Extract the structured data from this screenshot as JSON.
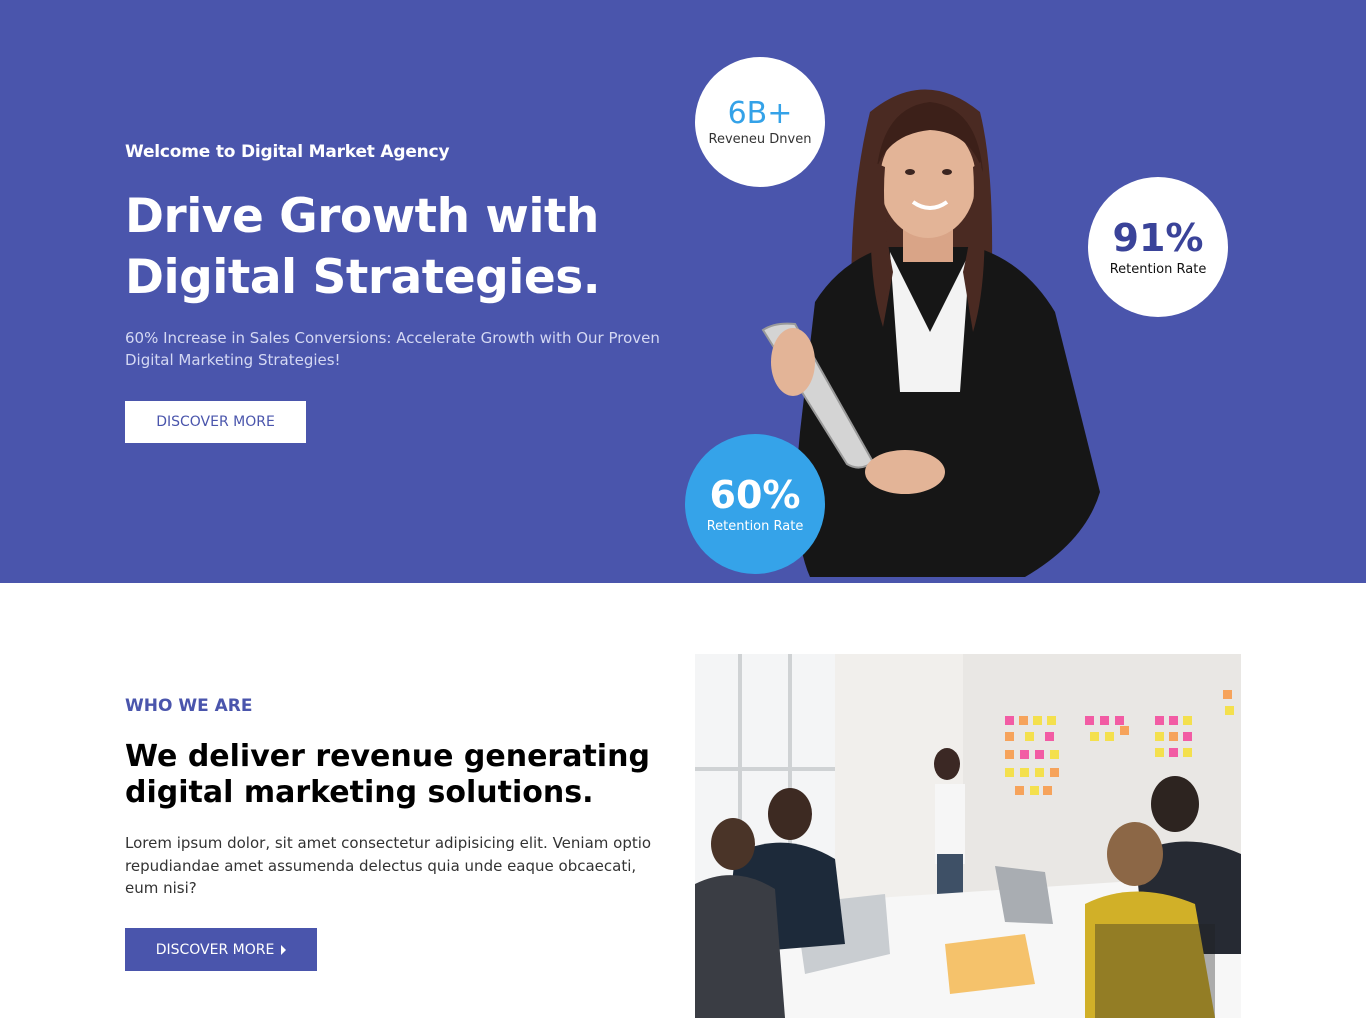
{
  "hero": {
    "eyebrow": "Welcome to Digital Market Agency",
    "title": "Drive Growth with Digital Strategies.",
    "subtitle": "60% Increase in Sales Conversions: Accelerate Growth with Our Proven Digital Marketing Strategies!",
    "button_label": "DISCOVER MORE",
    "background_color": "#4a55ac",
    "stats": [
      {
        "value": "6B+",
        "label": "Reveneu Dnven"
      },
      {
        "value": "91%",
        "label": "Retention Rate"
      },
      {
        "value": "60%",
        "label": "Retention Rate"
      }
    ]
  },
  "about": {
    "eyebrow": "WHO WE ARE",
    "title": "We deliver revenue generating digital marketing solutions.",
    "text": "Lorem ipsum dolor, sit amet consectetur adipisicing elit. Veniam optio repudiandae amet assumenda delectus quia unde eaque obcaecati, eum nisi?",
    "button_label": "DISCOVER MORE",
    "button_icon": "caret-right-icon"
  },
  "colors": {
    "brand": "#4a55ac",
    "accent_blue": "#35a3e9",
    "white": "#ffffff"
  }
}
